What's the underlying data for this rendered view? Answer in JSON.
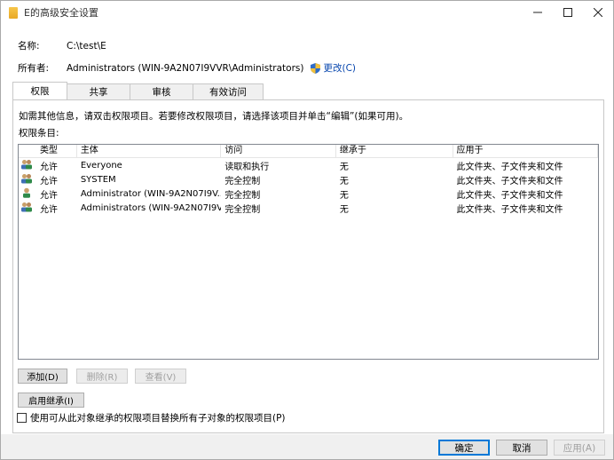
{
  "window": {
    "title": "E的高级安全设置"
  },
  "info": {
    "name_label": "名称:",
    "name_value": "C:\\test\\E",
    "owner_label": "所有者:",
    "owner_value": "Administrators (WIN-9A2N07I9VVR\\Administrators)",
    "change_link": "更改(C)"
  },
  "tabs": [
    {
      "label": "权限"
    },
    {
      "label": "共享"
    },
    {
      "label": "审核"
    },
    {
      "label": "有效访问"
    }
  ],
  "panel": {
    "hint": "如需其他信息，请双击权限项目。若要修改权限项目，请选择该项目并单击“编辑”(如果可用)。",
    "list_label": "权限条目:"
  },
  "table": {
    "headers": [
      "类型",
      "主体",
      "访问",
      "继承于",
      "应用于"
    ],
    "rows": [
      {
        "icon": "users-icon",
        "type": "允许",
        "principal": "Everyone",
        "access": "读取和执行",
        "inherited": "无",
        "applies": "此文件夹、子文件夹和文件"
      },
      {
        "icon": "users-icon",
        "type": "允许",
        "principal": "SYSTEM",
        "access": "完全控制",
        "inherited": "无",
        "applies": "此文件夹、子文件夹和文件"
      },
      {
        "icon": "user-icon",
        "type": "允许",
        "principal": "Administrator (WIN-9A2N07I9V...",
        "access": "完全控制",
        "inherited": "无",
        "applies": "此文件夹、子文件夹和文件"
      },
      {
        "icon": "users-icon",
        "type": "允许",
        "principal": "Administrators (WIN-9A2N07I9V...",
        "access": "完全控制",
        "inherited": "无",
        "applies": "此文件夹、子文件夹和文件"
      }
    ]
  },
  "buttons": {
    "add": "添加(D)",
    "remove": "删除(R)",
    "view": "查看(V)",
    "enable_inheritance": "启用继承(I)"
  },
  "checkbox": {
    "label": "使用可从此对象继承的权限项目替换所有子对象的权限项目(P)"
  },
  "footer": {
    "ok": "确定",
    "cancel": "取消",
    "apply": "应用(A)"
  }
}
